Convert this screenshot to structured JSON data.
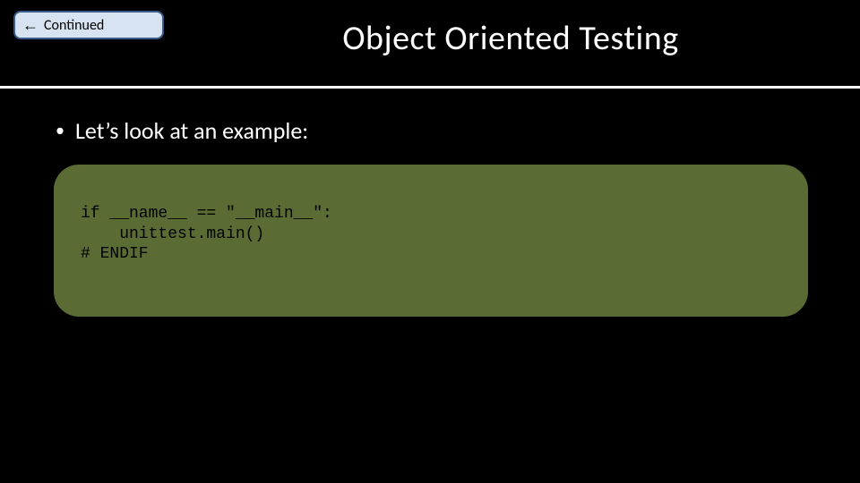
{
  "badge": {
    "arrow": "←",
    "label": "Continued"
  },
  "title": "Object Oriented Testing",
  "bullet": {
    "marker": "•",
    "text": "Let’s look at an example:"
  },
  "code": "if __name__ == \"__main__\":\n    unittest.main()\n# ENDIF"
}
